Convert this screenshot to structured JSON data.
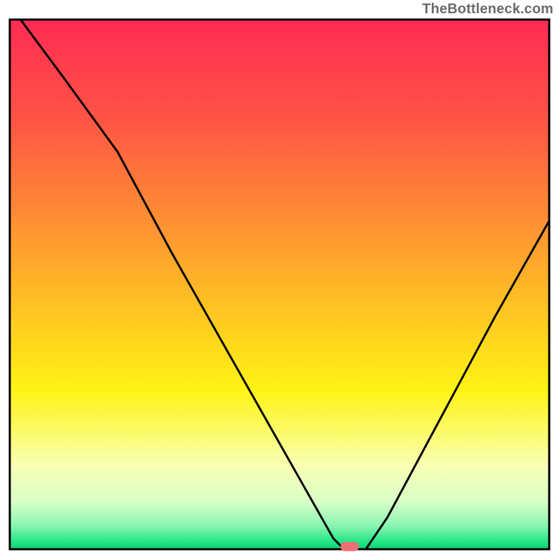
{
  "watermark": "TheBottleneck.com",
  "chart_data": {
    "type": "line",
    "title": "",
    "xlabel": "",
    "ylabel": "",
    "xlim": [
      0,
      100
    ],
    "ylim": [
      0,
      100
    ],
    "grid": false,
    "series": [
      {
        "name": "curve",
        "x": [
          2,
          10,
          20,
          30,
          40,
          50,
          60,
          62,
          64,
          66,
          70,
          80,
          90,
          100
        ],
        "y": [
          100,
          89,
          75,
          56,
          38,
          20,
          2,
          0,
          0,
          0,
          6,
          25,
          44,
          62
        ]
      }
    ],
    "marker": {
      "x": 63,
      "y": 0.5,
      "color": "#ee6f72"
    },
    "gradient_stops": [
      {
        "offset": 0.0,
        "color": "#ff2b53"
      },
      {
        "offset": 0.18,
        "color": "#ff5245"
      },
      {
        "offset": 0.38,
        "color": "#ff8f33"
      },
      {
        "offset": 0.55,
        "color": "#ffc522"
      },
      {
        "offset": 0.7,
        "color": "#fff314"
      },
      {
        "offset": 0.78,
        "color": "#fbfb6a"
      },
      {
        "offset": 0.84,
        "color": "#faffb3"
      },
      {
        "offset": 0.91,
        "color": "#d9ffc7"
      },
      {
        "offset": 0.955,
        "color": "#8cf5b1"
      },
      {
        "offset": 0.985,
        "color": "#27e587"
      },
      {
        "offset": 1.0,
        "color": "#09d571"
      }
    ],
    "frame_color": "#000000",
    "line_color": "#000000",
    "line_width": 3
  }
}
